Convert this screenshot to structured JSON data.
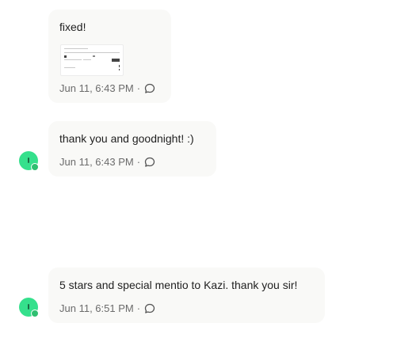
{
  "messages": [
    {
      "text": "fixed!",
      "time": "Jun 11, 6:43 PM",
      "separator": "·",
      "has_attachment": true,
      "reply_icon": "comment-icon"
    },
    {
      "text": "thank you and goodnight! :)",
      "time": "Jun 11, 6:43 PM",
      "separator": "·",
      "reply_icon": "comment-icon"
    },
    {
      "text": "5 stars and special mentio to Kazi. thank you sir!",
      "time": "Jun 11, 6:51 PM",
      "separator": "·",
      "reply_icon": "comment-icon"
    }
  ],
  "colors": {
    "avatar": "#35e08c",
    "presence": "#2fbf71",
    "bubble": "#f9f9f7"
  }
}
